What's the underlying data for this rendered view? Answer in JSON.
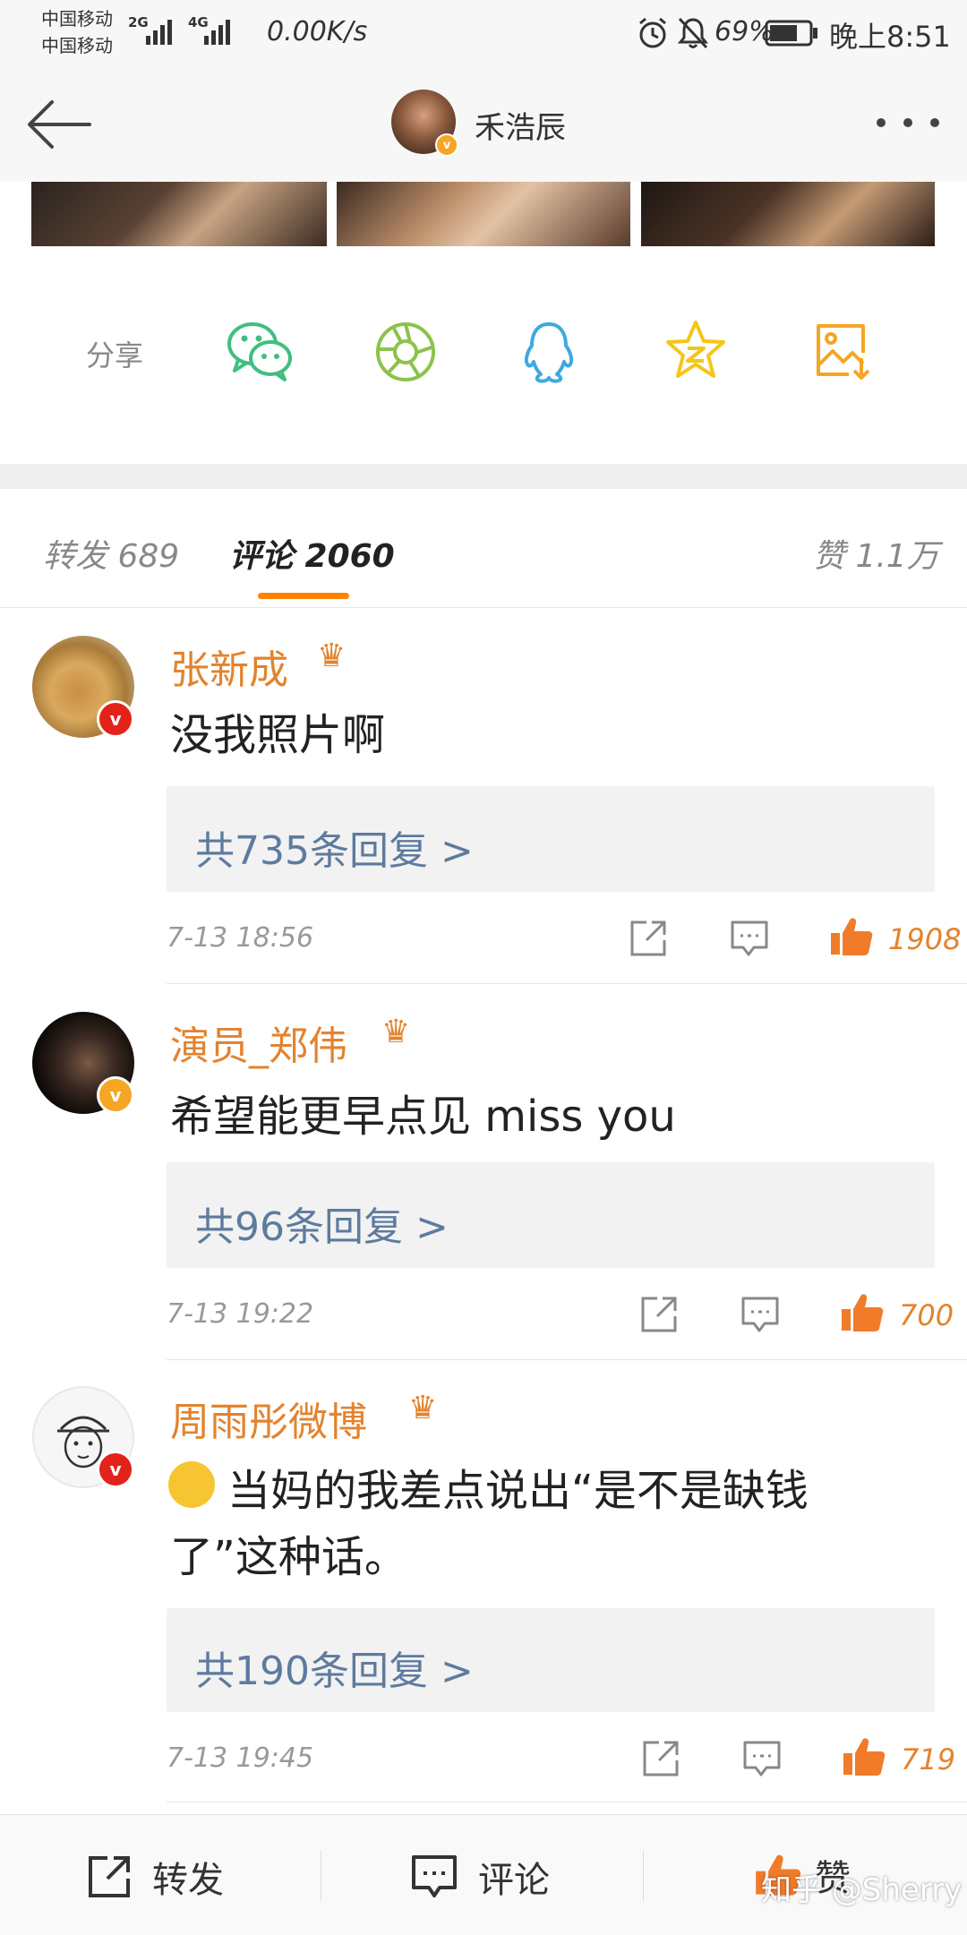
{
  "status_bar": {
    "carrier1": "中国移动",
    "carrier2": "中国移动",
    "net1": "2G",
    "net2": "4G",
    "speed": "0.00K/s",
    "battery": "69%",
    "time": "晚上8:51"
  },
  "nav": {
    "title": "禾浩辰",
    "back_icon": "back-arrow-icon",
    "more_icon": "more-dots-icon"
  },
  "share": {
    "label": "分享",
    "items": [
      "wechat-icon",
      "moments-icon",
      "qq-icon",
      "qzone-icon",
      "save-image-icon"
    ]
  },
  "tabs": {
    "repost": "转发 689",
    "comments": "评论 2060",
    "likes": "赞 1.1万"
  },
  "comments": [
    {
      "name": "张新成",
      "text": "没我照片啊",
      "replies": "共735条回复 >",
      "time": "7-13 18:56",
      "likes": "1908"
    },
    {
      "name": "演员_郑伟",
      "text": "希望能更早点见 miss you",
      "replies": "共96条回复 >",
      "time": "7-13 19:22",
      "likes": "700"
    },
    {
      "name": "周雨彤微博",
      "text": "当妈的我差点说出“是不是缺钱了”这种话。",
      "replies": "共190条回复 >",
      "time": "7-13 19:45",
      "likes": "719"
    }
  ],
  "bottom_bar": {
    "repost": "转发",
    "comment": "评论",
    "like": "赞"
  },
  "watermark": "知乎 @Sherry",
  "colors": {
    "accent": "#ff8200",
    "username": "#e3832d",
    "reply_link": "#5d7b9e"
  }
}
